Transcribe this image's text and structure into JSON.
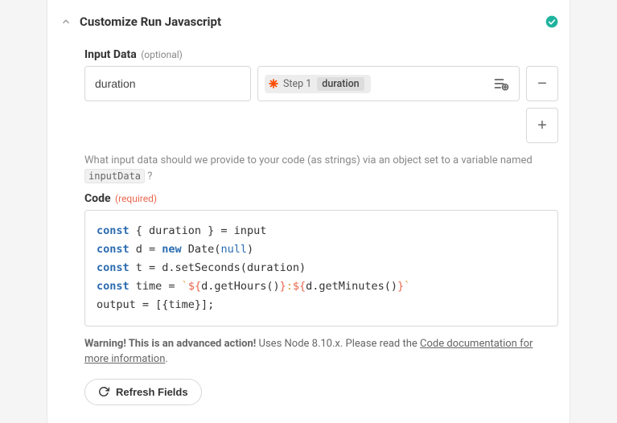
{
  "header": {
    "title": "Customize Run Javascript"
  },
  "fields": {
    "inputData": {
      "label": "Input Data",
      "optional": "(optional)",
      "value": "duration",
      "stepLabel": "Step 1",
      "stepField": "duration"
    },
    "code": {
      "label": "Code",
      "required": "(required)"
    }
  },
  "helper": {
    "prefix": "What input data should we provide to your code (as strings) via an object set to a variable named ",
    "code": "inputData",
    "suffix": " ?"
  },
  "codeTokens": {
    "kw": "const",
    "newkw": "new",
    "nullkw": "null",
    "l1a": " { duration } = input",
    "l2a": " d = ",
    "l2b": " Date(",
    "l2c": ")",
    "l3a": " t = d.setSeconds(duration)",
    "l4a": " time = ",
    "l4q": "`",
    "l4b": "${",
    "l4c": "d.getHours()",
    "l4d": "}",
    "l4colon": ":",
    "l4e": "${",
    "l4f": "d.getMinutes()",
    "l4g": "}",
    "l5": "output = [{time}];"
  },
  "warning": {
    "bold": "Warning! This is an advanced action!",
    "text": " Uses Node 8.10.x. Please read the ",
    "linkText": "Code documentation for more information",
    "period": "."
  },
  "buttons": {
    "refresh": "Refresh Fields",
    "minus": "−",
    "plus": "+"
  }
}
